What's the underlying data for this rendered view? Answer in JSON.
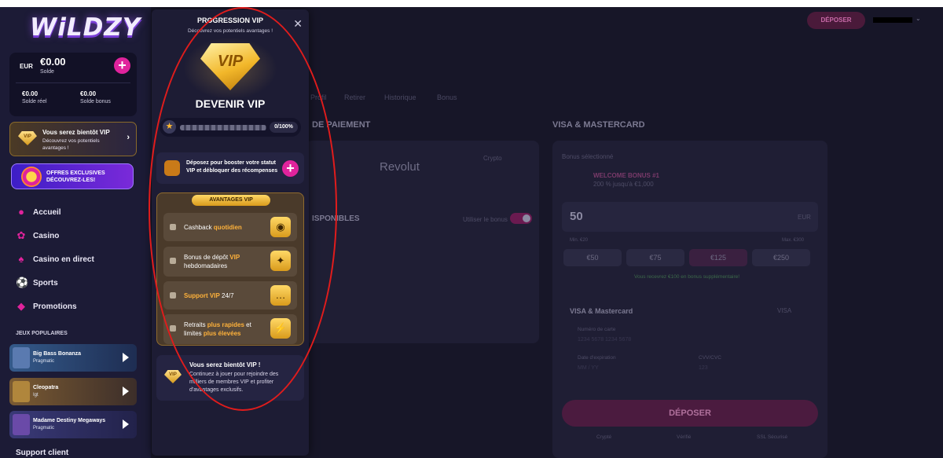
{
  "sidebar": {
    "logo": "WiLDZY",
    "wallet": {
      "currency": "EUR",
      "balance": "€0.00",
      "balance_label": "Solde",
      "real_value": "€0.00",
      "real_label": "Solde réel",
      "bonus_value": "€0.00",
      "bonus_label": "Solde bonus",
      "plus": "+"
    },
    "vip_card": {
      "gem": "VIP",
      "title": "Vous serez bientôt VIP",
      "subtitle": "Découvrez vos potentiels avantages !",
      "arrow": "›"
    },
    "offers": {
      "line1": "OFFRES EXCLUSIVES",
      "line2": "DÉCOUVREZ-LES!"
    },
    "nav": [
      {
        "icon": "●",
        "label": "Accueil"
      },
      {
        "icon": "✿",
        "label": "Casino"
      },
      {
        "icon": "♠",
        "label": "Casino en direct"
      },
      {
        "icon": "⚽",
        "label": "Sports"
      },
      {
        "icon": "◆",
        "label": "Promotions"
      }
    ],
    "popular_title": "JEUX POPULAIRES",
    "games": [
      {
        "name": "Big Bass Bonanza",
        "provider": "Pragmatic"
      },
      {
        "name": "Cleopatra",
        "provider": "Igt"
      },
      {
        "name": "Madame Destiny Megaways",
        "provider": "Pragmatic"
      }
    ],
    "support": "Support client"
  },
  "vip_panel": {
    "title": "PROGRESSION VIP",
    "subtitle": "Découvrez vos potentiels avantages !",
    "close": "✕",
    "gem_label": "VIP",
    "heading": "DEVENIR VIP",
    "progress": {
      "percent": 0,
      "label": "0/100%"
    },
    "deposit_text": "Déposez pour booster votre statut VIP et débloquer des récompenses",
    "advantages_badge": "AVANTAGES VIP",
    "advantages": [
      {
        "pre": "Cashback ",
        "hl": "quotidien",
        "post": "",
        "icon": "◉"
      },
      {
        "pre": "Bonus de dépôt ",
        "hl": "VIP",
        "post": " hebdomadaires",
        "icon": "✦"
      },
      {
        "pre": "",
        "hl": "Support VIP",
        "post": " 24/7",
        "icon": "…"
      },
      {
        "pre": "Retraits ",
        "hl": "plus rapides",
        "post": " et limites ",
        "hl2": "plus élevées",
        "icon": "⚡"
      }
    ],
    "soon": {
      "gem": "VIP",
      "title": "Vous serez bientôt VIP !",
      "text": "Continuez à jouer pour rejoindre des milliers de membres VIP et profiter d'avantages exclusifs."
    }
  },
  "main": {
    "header_deposit": "DÉPOSER",
    "tabs": [
      "Profil",
      "Retirer",
      "Historique",
      "Bonus"
    ],
    "payment_heading": "DE PAIEMENT",
    "visa_heading": "VISA & MASTERCARD",
    "revolut": "Revolut",
    "crypto": "Crypto",
    "available": "ISPONIBLES",
    "use_bonus": "Utiliser le bonus",
    "selected_bonus": "Bonus sélectionné",
    "welcome_bonus": "WELCOME BONUS #1",
    "welcome_detail": "200 % jusqu'à €1,000",
    "amount": "50",
    "amount_currency": "EUR",
    "min": "Min. €20",
    "max": "Max. €300",
    "chips": [
      "€50",
      "€75",
      "€125",
      "€250"
    ],
    "extra_bonus": "Vous recevrez €100 en bonus supplémentaire!",
    "visa_mc": "VISA & Mastercard",
    "visa": "VISA",
    "card_number": "Numéro de carte",
    "card_number_ph": "1234 5678 1234 5678",
    "expiry": "Date d'expiration",
    "expiry_ph": "MM / YY",
    "cvv": "CVV/CVC",
    "cvv_ph": "123",
    "deposit_btn": "DÉPOSER",
    "secure": [
      "Crypté",
      "Vérifié",
      "SSL Sécurisé"
    ]
  },
  "colors": {
    "accent": "#e0239c",
    "gold": "#f2b72a",
    "annotation": "#e01c1c"
  }
}
